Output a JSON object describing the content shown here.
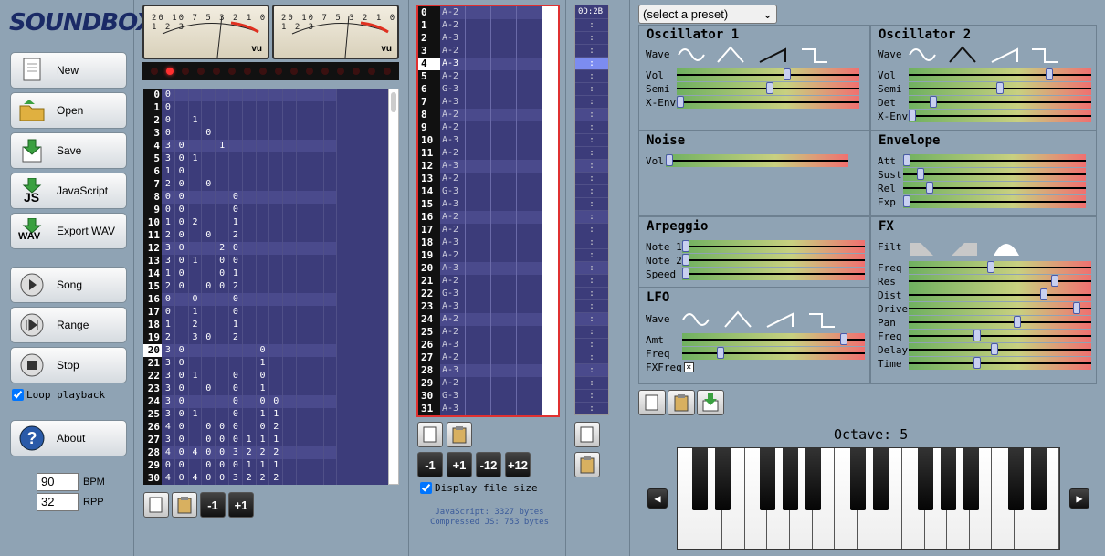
{
  "app": {
    "title": "SOUNDBOX"
  },
  "sidebar": {
    "buttons": [
      {
        "label": "New",
        "icon": "new-document-icon"
      },
      {
        "label": "Open",
        "icon": "open-folder-icon"
      },
      {
        "label": "Save",
        "icon": "save-icon"
      },
      {
        "label": "JavaScript",
        "icon": "javascript-export-icon",
        "badge": "JS"
      },
      {
        "label": "Export WAV",
        "icon": "wav-export-icon",
        "badge": "WAV"
      },
      {
        "label": "Song",
        "icon": "play-icon"
      },
      {
        "label": "Range",
        "icon": "play-range-icon"
      },
      {
        "label": "Stop",
        "icon": "stop-icon"
      },
      {
        "label": "About",
        "icon": "help-icon"
      }
    ],
    "loop_label": "Loop playback",
    "loop_checked": true,
    "bpm_value": "90",
    "bpm_label": "BPM",
    "rpp_value": "32",
    "rpp_label": "RPP"
  },
  "vu": {
    "scale_left": "20 10 7 5 3 2 1 0 1 2 3",
    "scale_right": "20 10 7 5 3 2 1 0 1 2 3",
    "label": "vu",
    "minus": "−",
    "plus": "+"
  },
  "pattern": {
    "rows": [
      [
        "0",
        "0",
        "",
        "",
        "",
        "",
        "",
        "",
        "",
        "",
        "",
        "",
        "",
        ""
      ],
      [
        "1",
        "0",
        "",
        "",
        "",
        "",
        "",
        "",
        "",
        "",
        "",
        "",
        "",
        ""
      ],
      [
        "2",
        "0",
        "",
        "1",
        "",
        "",
        "",
        "",
        "",
        "",
        "",
        "",
        "",
        ""
      ],
      [
        "3",
        "0",
        "",
        "",
        "0",
        "",
        "",
        "",
        "",
        "",
        "",
        "",
        "",
        ""
      ],
      [
        "4",
        "3",
        "0",
        "",
        "",
        "1",
        "",
        "",
        "",
        "",
        "",
        "",
        "",
        ""
      ],
      [
        "5",
        "3",
        "0",
        "1",
        "",
        "",
        "",
        "",
        "",
        "",
        "",
        "",
        "",
        ""
      ],
      [
        "6",
        "1",
        "0",
        "",
        "",
        "",
        "",
        "",
        "",
        "",
        "",
        "",
        "",
        ""
      ],
      [
        "7",
        "2",
        "0",
        "",
        "0",
        "",
        "",
        "",
        "",
        "",
        "",
        "",
        "",
        ""
      ],
      [
        "8",
        "0",
        "0",
        "",
        "",
        "",
        "0",
        "",
        "",
        "",
        "",
        "",
        "",
        ""
      ],
      [
        "9",
        "0",
        "0",
        "",
        "",
        "",
        "0",
        "",
        "",
        "",
        "",
        "",
        "",
        ""
      ],
      [
        "10",
        "1",
        "0",
        "2",
        "",
        "",
        "1",
        "",
        "",
        "",
        "",
        "",
        "",
        ""
      ],
      [
        "11",
        "2",
        "0",
        "",
        "0",
        "",
        "2",
        "",
        "",
        "",
        "",
        "",
        "",
        ""
      ],
      [
        "12",
        "3",
        "0",
        "",
        "",
        "2",
        "0",
        "",
        "",
        "",
        "",
        "",
        "",
        ""
      ],
      [
        "13",
        "3",
        "0",
        "1",
        "",
        "0",
        "0",
        "",
        "",
        "",
        "",
        "",
        "",
        ""
      ],
      [
        "14",
        "1",
        "0",
        "",
        "",
        "0",
        "1",
        "",
        "",
        "",
        "",
        "",
        "",
        ""
      ],
      [
        "15",
        "2",
        "0",
        "",
        "0",
        "0",
        "2",
        "",
        "",
        "",
        "",
        "",
        "",
        ""
      ],
      [
        "16",
        "0",
        "",
        "0",
        "",
        "",
        "0",
        "",
        "",
        "",
        "",
        "",
        "",
        ""
      ],
      [
        "17",
        "0",
        "",
        "1",
        "",
        "",
        "0",
        "",
        "",
        "",
        "",
        "",
        "",
        ""
      ],
      [
        "18",
        "1",
        "",
        "2",
        "",
        "",
        "1",
        "",
        "",
        "",
        "",
        "",
        "",
        ""
      ],
      [
        "19",
        "2",
        "",
        "3",
        "0",
        "",
        "2",
        "",
        "",
        "",
        "",
        "",
        "",
        ""
      ],
      [
        "20",
        "3",
        "0",
        "",
        "",
        "",
        "",
        "",
        "0",
        "",
        "",
        "",
        "",
        ""
      ],
      [
        "21",
        "3",
        "0",
        "",
        "",
        "",
        "",
        "",
        "1",
        "",
        "",
        "",
        "",
        ""
      ],
      [
        "22",
        "3",
        "0",
        "1",
        "",
        "",
        "0",
        "",
        "0",
        "",
        "",
        "",
        "",
        ""
      ],
      [
        "23",
        "3",
        "0",
        "",
        "0",
        "",
        "0",
        "",
        "1",
        "",
        "",
        "",
        "",
        ""
      ],
      [
        "24",
        "3",
        "0",
        "",
        "",
        "",
        "0",
        "",
        "0",
        "0",
        "",
        "",
        "",
        ""
      ],
      [
        "25",
        "3",
        "0",
        "1",
        "",
        "",
        "0",
        "",
        "1",
        "1",
        "",
        "",
        "",
        ""
      ],
      [
        "26",
        "4",
        "0",
        "",
        "0",
        "0",
        "0",
        "",
        "0",
        "2",
        "",
        "",
        "",
        ""
      ],
      [
        "27",
        "3",
        "0",
        "",
        "0",
        "0",
        "0",
        "1",
        "1",
        "1",
        "",
        "",
        "",
        ""
      ],
      [
        "28",
        "4",
        "0",
        "4",
        "0",
        "0",
        "3",
        "2",
        "2",
        "2",
        "",
        "",
        "",
        ""
      ],
      [
        "29",
        "0",
        "0",
        "",
        "0",
        "0",
        "0",
        "1",
        "1",
        "1",
        "",
        "",
        "",
        ""
      ],
      [
        "30",
        "4",
        "0",
        "4",
        "0",
        "0",
        "3",
        "2",
        "2",
        "2",
        "",
        "",
        "",
        ""
      ]
    ]
  },
  "pattern_buttons": {
    "minus1": "-1",
    "plus1": "+1"
  },
  "sequence": {
    "rows": [
      [
        "0",
        "A-2"
      ],
      [
        "1",
        "A-2"
      ],
      [
        "2",
        "A-3"
      ],
      [
        "3",
        "A-2"
      ],
      [
        "4",
        "A-3"
      ],
      [
        "5",
        "A-2"
      ],
      [
        "6",
        "G-3"
      ],
      [
        "7",
        "A-3"
      ],
      [
        "8",
        "A-2"
      ],
      [
        "9",
        "A-2"
      ],
      [
        "10",
        "A-3"
      ],
      [
        "11",
        "A-2"
      ],
      [
        "12",
        "A-3"
      ],
      [
        "13",
        "A-2"
      ],
      [
        "14",
        "G-3"
      ],
      [
        "15",
        "A-3"
      ],
      [
        "16",
        "A-2"
      ],
      [
        "17",
        "A-2"
      ],
      [
        "18",
        "A-3"
      ],
      [
        "19",
        "A-2"
      ],
      [
        "20",
        "A-3"
      ],
      [
        "21",
        "A-2"
      ],
      [
        "22",
        "G-3"
      ],
      [
        "23",
        "A-3"
      ],
      [
        "24",
        "A-2"
      ],
      [
        "25",
        "A-2"
      ],
      [
        "26",
        "A-3"
      ],
      [
        "27",
        "A-2"
      ],
      [
        "28",
        "A-3"
      ],
      [
        "29",
        "A-2"
      ],
      [
        "30",
        "G-3"
      ],
      [
        "31",
        "A-3"
      ]
    ]
  },
  "seq_buttons": {
    "m1": "-1",
    "p1": "+1",
    "m12": "-12",
    "p12": "+12"
  },
  "display_file_size": {
    "label": "Display file size",
    "checked": true
  },
  "size_info": {
    "js": "JavaScript: 3327 bytes",
    "compressed": "Compressed JS: 753 bytes"
  },
  "fx": {
    "header": "0D:2B",
    "cell": ":"
  },
  "instrument": {
    "preset": "(select a preset)",
    "osc1": {
      "title": "Oscillator 1",
      "wave_label": "Wave",
      "sliders": [
        {
          "label": "Vol",
          "value": 0.61
        },
        {
          "label": "Semi",
          "value": 0.51
        },
        {
          "label": "X-Env",
          "value": 0.0
        }
      ]
    },
    "osc2": {
      "title": "Oscillator 2",
      "wave_label": "Wave",
      "sliders": [
        {
          "label": "Vol",
          "value": 0.78
        },
        {
          "label": "Semi",
          "value": 0.5
        },
        {
          "label": "Det",
          "value": 0.12
        },
        {
          "label": "X-Env",
          "value": 0.0
        }
      ]
    },
    "noise": {
      "title": "Noise",
      "sliders": [
        {
          "label": "Vol",
          "value": 0.0
        }
      ]
    },
    "envelope": {
      "title": "Envelope",
      "sliders": [
        {
          "label": "Att",
          "value": 0.0
        },
        {
          "label": "Sust",
          "value": 0.08
        },
        {
          "label": "Rel",
          "value": 0.13
        },
        {
          "label": "Exp",
          "value": 0.0
        }
      ]
    },
    "arpeggio": {
      "title": "Arpeggio",
      "sliders": [
        {
          "label": "Note 1",
          "value": 0.0
        },
        {
          "label": "Note 2",
          "value": 0.0
        },
        {
          "label": "Speed",
          "value": 0.0
        }
      ]
    },
    "fxpanel": {
      "title": "FX",
      "filt_label": "Filt",
      "sliders": [
        {
          "label": "Freq",
          "value": 0.45
        },
        {
          "label": "Res",
          "value": 0.81
        },
        {
          "label": "Dist",
          "value": 0.75
        },
        {
          "label": "Drive",
          "value": 0.94
        },
        {
          "label": "Pan",
          "value": 0.6
        },
        {
          "label": "Freq",
          "value": 0.37
        },
        {
          "label": "Delay",
          "value": 0.47
        },
        {
          "label": "Time",
          "value": 0.37
        }
      ]
    },
    "lfo": {
      "title": "LFO",
      "wave_label": "Wave",
      "sliders": [
        {
          "label": "Amt",
          "value": 0.9
        },
        {
          "label": "Freq",
          "value": 0.2
        }
      ],
      "fxfreq_label": "FXFreq",
      "fxfreq_mark": "×"
    }
  },
  "octave": {
    "label": "Octave: 5"
  },
  "keyboard": {
    "prev": "◀",
    "next": "▶"
  }
}
